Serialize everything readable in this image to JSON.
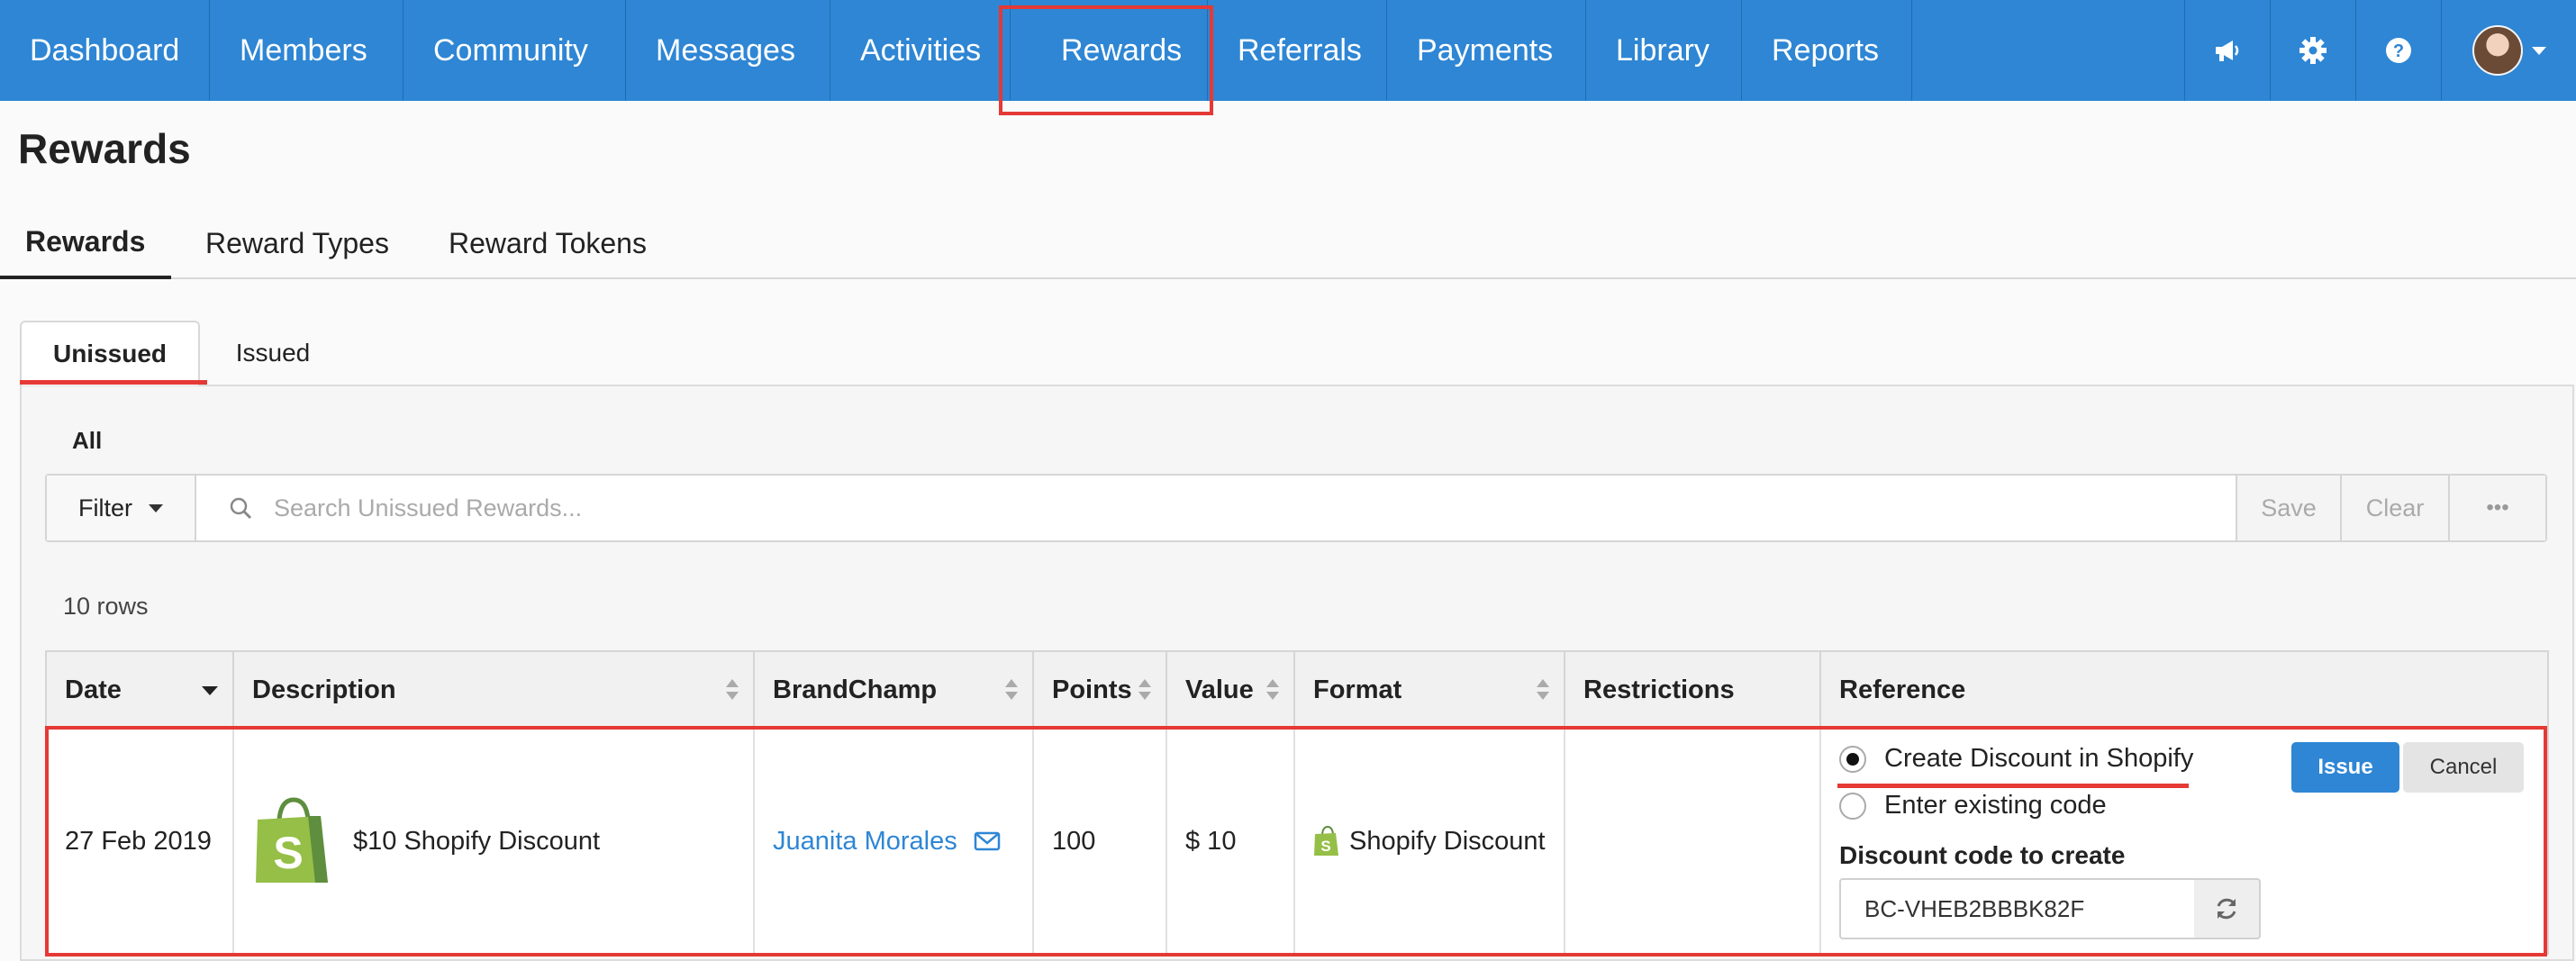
{
  "nav": {
    "items": [
      {
        "label": "Dashboard"
      },
      {
        "label": "Members"
      },
      {
        "label": "Community"
      },
      {
        "label": "Messages"
      },
      {
        "label": "Activities"
      },
      {
        "label": "Rewards"
      },
      {
        "label": "Referrals"
      },
      {
        "label": "Payments"
      },
      {
        "label": "Library"
      },
      {
        "label": "Reports"
      }
    ],
    "active": "Rewards",
    "icons": [
      "megaphone-icon",
      "gear-icon",
      "help-icon",
      "avatar"
    ]
  },
  "page": {
    "title": "Rewards",
    "subtabs": [
      "Rewards",
      "Reward Types",
      "Reward Tokens"
    ],
    "inner_tabs": [
      "Unissued",
      "Issued"
    ],
    "filter_group": "All"
  },
  "filterbar": {
    "filter_label": "Filter",
    "search_placeholder": "Search Unissued Rewards...",
    "save_label": "Save",
    "clear_label": "Clear",
    "more_label": "•••"
  },
  "table": {
    "rows_count": "10 rows",
    "columns": [
      "Date",
      "Description",
      "BrandChamp",
      "Points",
      "Value",
      "Format",
      "Restrictions",
      "Reference"
    ],
    "rows": [
      {
        "date": "27 Feb 2019",
        "description": "$10 Shopify Discount",
        "brandchamp": "Juanita Morales",
        "points": "100",
        "value": "$ 10",
        "format": "Shopify Discount",
        "restrictions": "",
        "reference": {
          "option_create": "Create Discount in Shopify",
          "option_existing": "Enter existing code",
          "selected": "create",
          "code_label": "Discount code to create",
          "code_value": "BC-VHEB2BBBK82F",
          "issue_label": "Issue",
          "cancel_label": "Cancel"
        }
      }
    ]
  },
  "colors": {
    "nav_bg": "#2e86d4",
    "accent": "#2e86d4",
    "highlight": "#e53935",
    "shopify_green": "#95bf47"
  }
}
